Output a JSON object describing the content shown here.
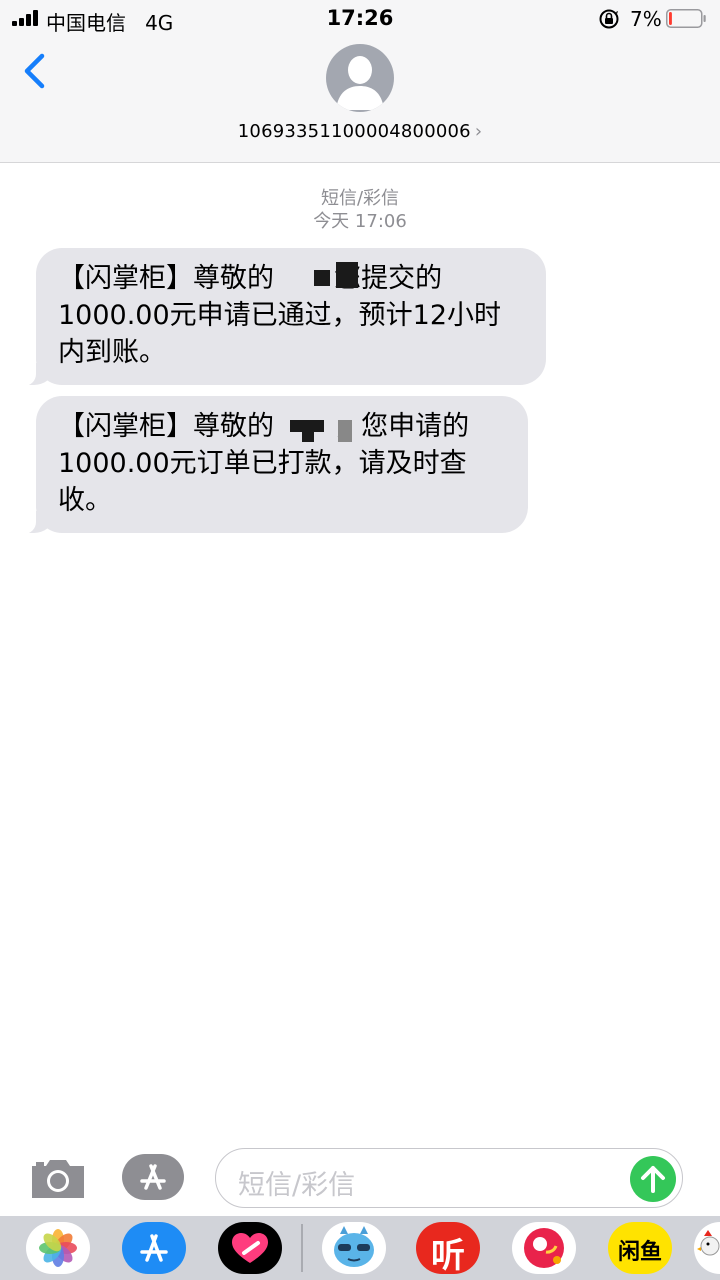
{
  "status_bar": {
    "carrier": "中国电信",
    "network": "4G",
    "time": "17:26",
    "battery_percent": "7%",
    "battery_level": 0.07
  },
  "header": {
    "contact_number": "10693351100004800006",
    "disclosure": "›"
  },
  "thread": {
    "message_type": "短信/彩信",
    "timestamp": "今天 17:06",
    "messages": [
      {
        "text": "【闪掌柜】尊敬的       您提交的\n1000.00元申请已通过，预计12小时\n内到账。"
      },
      {
        "text": "【闪掌柜】尊敬的       ，您申请的\n1000.00元订单已打款，请及时查\n收。"
      }
    ]
  },
  "input_bar": {
    "placeholder": "短信/彩信"
  },
  "app_drawer": {
    "apps": [
      "photos-icon",
      "app-store-icon",
      "heart-app-icon",
      "sticker-face-icon",
      "ting-app-icon",
      "red-app-icon",
      "xianyu-app-icon",
      "rooster-app-icon"
    ],
    "ting_label": "听",
    "xianyu_label": "闲鱼"
  },
  "colors": {
    "accent": "#157efb",
    "bubble": "#e5e5ea",
    "send": "#34c759",
    "meta": "#8e8e93"
  }
}
